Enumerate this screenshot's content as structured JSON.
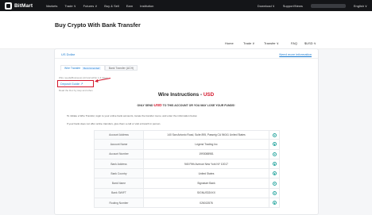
{
  "topnav": {
    "logo_text": "BitMart",
    "links": [
      "Markets",
      "Trade ∨",
      "Futures ∨",
      "Buy & Sell",
      "Earn",
      "Institution"
    ],
    "right_links": [
      "Download ∨",
      "Support/News",
      "English ∨"
    ]
  },
  "hero": {
    "title": "Buy Crypto With Bank Transfer"
  },
  "subnav": [
    "Home",
    "Trade ∨",
    "Transfer ∨",
    "FAQ",
    "$USD ∨"
  ],
  "card": {
    "title": "US Dollar",
    "help_link": "Need more information",
    "tabs": [
      {
        "label": "Wire Transfer",
        "badge": "Recommended"
      },
      {
        "label": "Bank Transfer (ACH)",
        "badge": ""
      }
    ],
    "arrival_note": "Wire needs(Business) (Arrival within 1-3 days)",
    "deposit_guide": "Deposit Guide ↗",
    "deposit_sub": "Read the Doc by step and when",
    "wire_title": "Wire Instructions - ",
    "wire_currency": "USD",
    "warning_pre": "ONLY SEND ",
    "warning_currency": "USD",
    "warning_post": " TO THIS ACCOUNT OR YOU MAY LOSE YOUR FUNDS!",
    "para1": "To initiate a Wire Transfer, login to your online bank accounts, locate the transfer menu, and enter the information below.",
    "para2": "If your bank does not offer online transfers, give them a call or visit a branch in person.",
    "rows": [
      {
        "label": "Account Address",
        "value": "140 San Antonio Road, Suite 895, Passeig CA 94041 United States"
      },
      {
        "label": "Account Name",
        "value": "Legend Trading Inc"
      },
      {
        "label": "Account Number",
        "value": "1993088981"
      },
      {
        "label": "Bank Address",
        "value": "945 Fifth Avenue New York NY 10017"
      },
      {
        "label": "Bank Country",
        "value": "United States"
      },
      {
        "label": "Bank Name",
        "value": "Signature Bank"
      },
      {
        "label": "Bank SWIFT",
        "value": "SIGNUS33XXX"
      },
      {
        "label": "Routing Number",
        "value": "026013576"
      }
    ]
  }
}
